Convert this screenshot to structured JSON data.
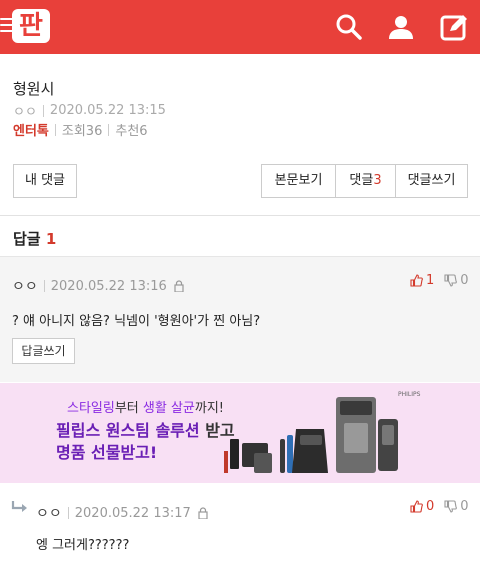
{
  "header": {
    "logo_text": "판",
    "brand_color": "#e8403a"
  },
  "post": {
    "title": "형원시",
    "author": "ㅇㅇ",
    "date": "2020.05.22 13:15",
    "category": "엔터톡",
    "views": "조회36",
    "recommends": "추천6"
  },
  "actions": {
    "my_comments": "내 댓글",
    "view_post": "본문보기",
    "comments_label": "댓글",
    "comments_count": "3",
    "write_comment": "댓글쓰기"
  },
  "replies": {
    "heading": "답글",
    "count": "1"
  },
  "comment1": {
    "author": "ㅇㅇ",
    "date": "2020.05.22 13:16",
    "text": "? 얘 아니지 않음? 닉넴이 '형원아'가 찐 아님?",
    "up": "1",
    "down": "0",
    "reply_button": "답글쓰기"
  },
  "ad": {
    "line1_a": "스타일링",
    "line1_b": "부터 ",
    "line1_c": "생활 살균",
    "line1_d": "까지!",
    "line2_a": "필립스 원스팀 솔루션",
    "line2_b": " 받고",
    "line3": "명품 선물받고!",
    "brand": "PHILIPS"
  },
  "comment2": {
    "author": "ㅇㅇ",
    "date": "2020.05.22 13:17",
    "text": "엥 그러게??????",
    "up": "0",
    "down": "0"
  },
  "icons": [
    "menu-icon",
    "search-icon",
    "user-icon",
    "write-icon",
    "lock-icon",
    "thumbs-up-icon",
    "thumbs-down-icon",
    "reply-arrow-icon"
  ]
}
